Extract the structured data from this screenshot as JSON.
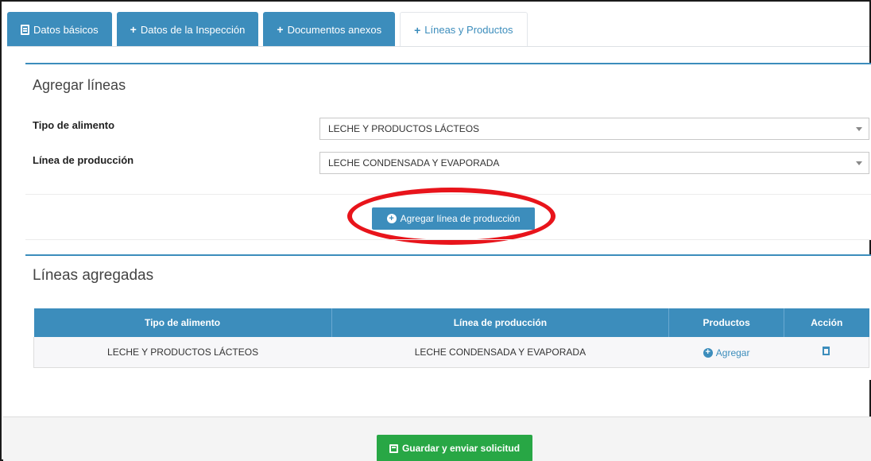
{
  "tabs": [
    {
      "label": "Datos básicos",
      "icon": "document-icon",
      "active": false
    },
    {
      "label": "Datos de la Inspección",
      "icon": "plus-icon",
      "active": false
    },
    {
      "label": "Documentos anexos",
      "icon": "plus-icon",
      "active": false
    },
    {
      "label": "Líneas y Productos",
      "icon": "plus-icon",
      "active": true
    }
  ],
  "add_lines": {
    "title": "Agregar líneas",
    "food_type_label": "Tipo de alimento",
    "food_type_value": "LECHE Y PRODUCTOS LÁCTEOS",
    "production_line_label": "Línea de producción",
    "production_line_value": "LECHE CONDENSADA Y EVAPORADA",
    "add_button_label": "Agregar línea de producción"
  },
  "added_lines": {
    "title": "Líneas agregadas",
    "columns": [
      "Tipo de alimento",
      "Línea de producción",
      "Productos",
      "Acción"
    ],
    "rows": [
      {
        "food_type": "LECHE Y PRODUCTOS LÁCTEOS",
        "production_line": "LECHE CONDENSADA Y EVAPORADA",
        "products_link": "Agregar"
      }
    ]
  },
  "footer": {
    "save_button_label": "Guardar y enviar solicitud"
  },
  "colors": {
    "primary": "#3c8dbc",
    "success": "#28a745",
    "highlight": "#e8141b"
  }
}
